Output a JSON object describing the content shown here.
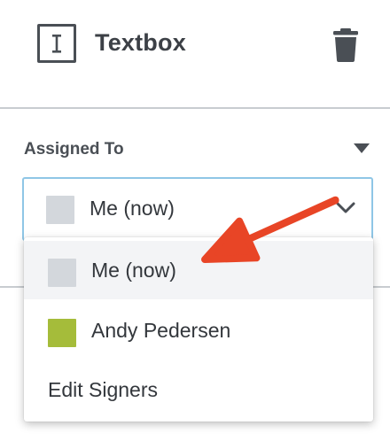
{
  "header": {
    "title": "Textbox",
    "field_icon": "text-cursor-icon",
    "delete_icon": "trash-icon"
  },
  "assignment": {
    "section_label": "Assigned To",
    "section_toggle_icon": "caret-down-icon",
    "selected_value": "Me (now)",
    "selected_swatch_color": "#d3d7dc",
    "dropdown_icon": "chevron-down-icon"
  },
  "menu": {
    "items": [
      {
        "label": "Me (now)",
        "swatch_color": "#d3d7dc",
        "selected": true
      },
      {
        "label": "Andy Pedersen",
        "swatch_color": "#a5bc3a",
        "selected": false
      }
    ],
    "edit_label": "Edit Signers"
  },
  "annotation": {
    "arrow_color": "#e84526"
  }
}
